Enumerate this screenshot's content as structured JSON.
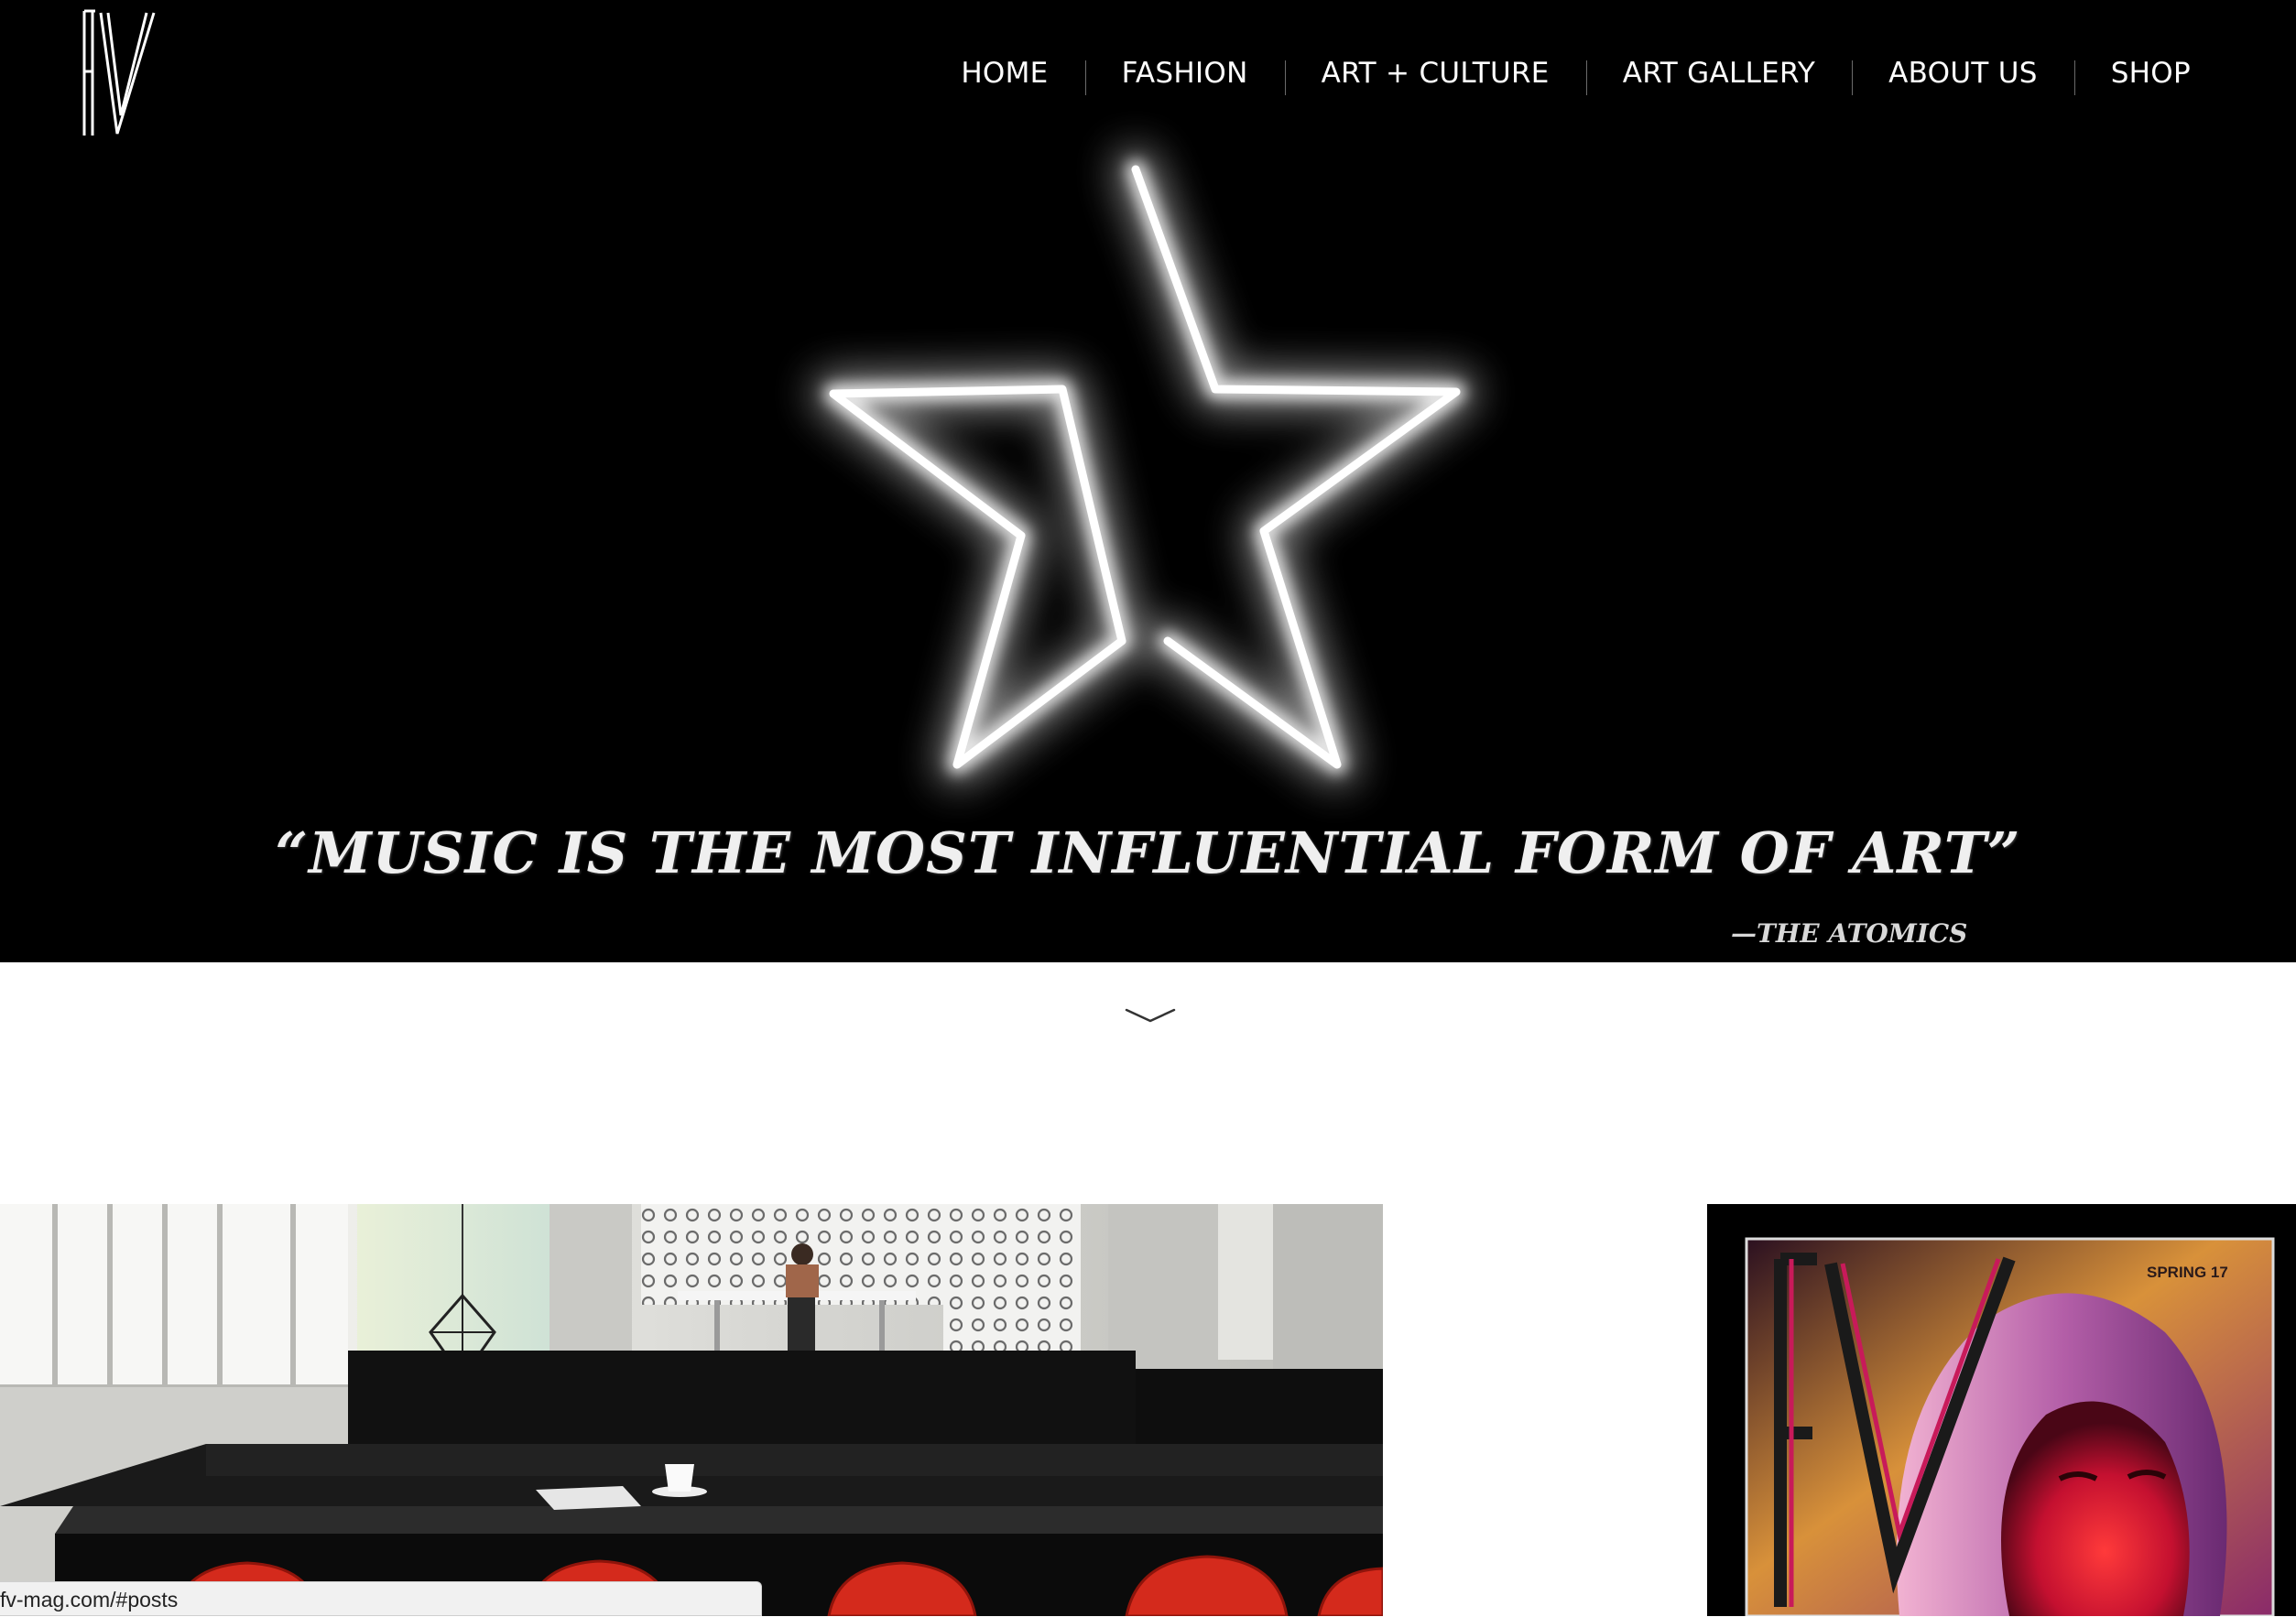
{
  "brand": {
    "logo_text": "FV"
  },
  "nav": {
    "items": [
      {
        "label": "HOME"
      },
      {
        "label": "FASHION"
      },
      {
        "label": "ART + CULTURE"
      },
      {
        "label": "ART GALLERY"
      },
      {
        "label": "ABOUT US"
      },
      {
        "label": "SHOP"
      }
    ]
  },
  "hero": {
    "quote": "“MUSIC IS THE MOST INFLUENTIAL FORM OF ART”",
    "attribution": "—THE ATOMICS"
  },
  "scroll": {
    "icon": "chevron-down-icon"
  },
  "posts": {
    "featured_image": "interior-cafe-photo",
    "cover": {
      "brand": "FV",
      "issue": "SPRING 17"
    }
  },
  "status_bar": {
    "url": "fv-mag.com/#posts"
  },
  "colors": {
    "hero_background": "#000000",
    "page_background": "#ffffff",
    "nav_text": "#ffffff",
    "cover_accent": "#c81a5a"
  }
}
